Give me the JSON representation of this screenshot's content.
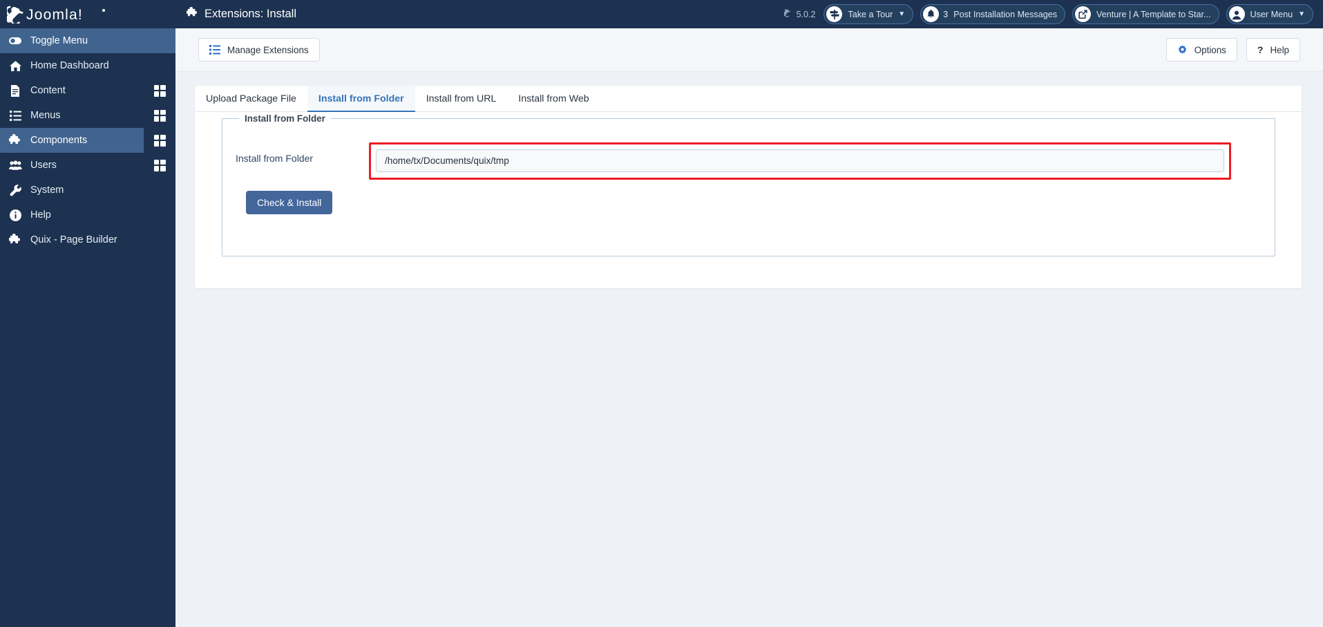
{
  "brand": {
    "name": "Joomla!",
    "logo_icon": "joomla-logo-icon"
  },
  "sidebar": {
    "toggle": {
      "label": "Toggle Menu",
      "icon": "toggle-switch-icon"
    },
    "items": [
      {
        "label": "Home Dashboard",
        "icon": "home-icon",
        "has_arrow": false,
        "has_grid": false,
        "active": false
      },
      {
        "label": "Content",
        "icon": "document-icon",
        "has_arrow": true,
        "has_grid": true,
        "active": false
      },
      {
        "label": "Menus",
        "icon": "list-icon",
        "has_arrow": true,
        "has_grid": true,
        "active": false
      },
      {
        "label": "Components",
        "icon": "puzzle-piece-icon",
        "has_arrow": true,
        "has_grid": true,
        "active": true
      },
      {
        "label": "Users",
        "icon": "users-icon",
        "has_arrow": true,
        "has_grid": true,
        "active": false
      },
      {
        "label": "System",
        "icon": "wrench-icon",
        "has_arrow": false,
        "has_grid": false,
        "active": false
      },
      {
        "label": "Help",
        "icon": "info-circle-icon",
        "has_arrow": false,
        "has_grid": false,
        "active": false
      },
      {
        "label": "Quix - Page Builder",
        "icon": "puzzle-piece-icon",
        "has_arrow": false,
        "has_grid": false,
        "active": false
      }
    ]
  },
  "header": {
    "title": "Extensions: Install",
    "title_icon": "puzzle-piece-icon",
    "version": "5.0.2",
    "version_icon": "joomla-mark-icon",
    "take_a_tour": {
      "label": "Take a Tour",
      "icon": "signpost-icon",
      "caret": "chevron-down-icon"
    },
    "post_install": {
      "label": "Post Installation Messages",
      "count": "3",
      "icon": "bell-icon"
    },
    "site_link": {
      "label": "Venture | A Template to Star...",
      "icon": "external-link-icon"
    },
    "user_menu": {
      "label": "User Menu",
      "icon": "user-circle-icon",
      "caret": "chevron-down-icon"
    }
  },
  "toolbar": {
    "manage_extensions": {
      "label": "Manage Extensions",
      "icon": "list-icon"
    },
    "options": {
      "label": "Options",
      "icon": "gear-icon"
    },
    "help": {
      "label": "Help",
      "icon": "question-mark-icon"
    }
  },
  "tabs": [
    {
      "label": "Upload Package File",
      "active": false
    },
    {
      "label": "Install from Folder",
      "active": true
    },
    {
      "label": "Install from URL",
      "active": false
    },
    {
      "label": "Install from Web",
      "active": false
    }
  ],
  "form": {
    "legend": "Install from Folder",
    "field_label": "Install from Folder",
    "field_value": "/home/tx/Documents/quix/tmp",
    "field_placeholder": "",
    "submit_label": "Check & Install"
  },
  "colors": {
    "sidebar_bg": "#1c3250",
    "sidebar_active": "#41648f",
    "accent_blue": "#3573b9",
    "button_blue": "#43669b",
    "highlight_red": "#ed1c24",
    "page_bg": "#eef2f6"
  }
}
